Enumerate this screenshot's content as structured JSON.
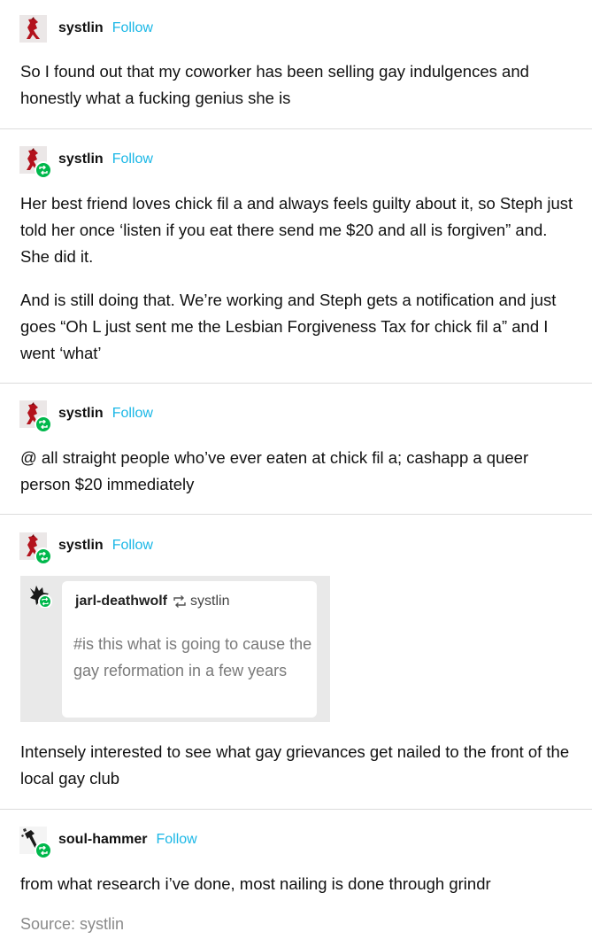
{
  "posts": [
    {
      "username": "systlin",
      "follow_label": "Follow",
      "paragraphs": [
        "So I found out that my coworker has been selling gay indulgences and honestly what a fucking genius she is"
      ]
    },
    {
      "username": "systlin",
      "follow_label": "Follow",
      "paragraphs": [
        "Her best friend loves chick fil a and always feels guilty about it, so Steph just told her once ‘listen if you eat there send me $20 and all is forgiven” and. She did it.",
        "And is still doing that. We’re working and Steph gets a notification and just goes “Oh L just sent me the Lesbian Forgiveness Tax for chick fil a” and I went ‘what’"
      ]
    },
    {
      "username": "systlin",
      "follow_label": "Follow",
      "paragraphs": [
        "@ all straight people who’ve ever eaten at chick fil a; cashapp a queer person $20 immediately"
      ]
    },
    {
      "username": "systlin",
      "follow_label": "Follow",
      "quote": {
        "username": "jarl-deathwolf",
        "reblogged_from": "systlin",
        "tags": "#is this what is going to cause the gay reformation in a few years"
      },
      "paragraphs": [
        "Intensely interested to see what gay grievances get nailed to the front of the local gay club"
      ]
    },
    {
      "username": "soul-hammer",
      "follow_label": "Follow",
      "paragraphs": [
        "from what research i’ve done, most nailing is done through grindr"
      ],
      "source": "Source: systlin"
    }
  ],
  "colors": {
    "follow": "#1ab7e6",
    "reblog_badge": "#00b84c",
    "divider": "#dcdcdc",
    "avatar_red": "#b3121c"
  },
  "icons": {
    "avatar_systlin": "red-horse-icon",
    "avatar_jarl": "black-wolf-icon",
    "avatar_soul": "hammer-icon",
    "badge": "reblog-icon"
  }
}
